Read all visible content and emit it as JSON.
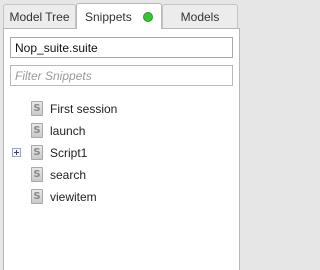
{
  "tabs": [
    {
      "label": "Model Tree",
      "active": false
    },
    {
      "label": "Snippets",
      "active": true,
      "status_color": "#37c437"
    },
    {
      "label": "Models",
      "active": false
    }
  ],
  "suite_input": {
    "value": "Nop_suite.suite"
  },
  "filter_input": {
    "placeholder": "Filter Snippets"
  },
  "snippet_icon_glyph": "S",
  "snippets": [
    {
      "label": "First session",
      "expandable": false
    },
    {
      "label": "launch",
      "expandable": false
    },
    {
      "label": "Script1",
      "expandable": true
    },
    {
      "label": "search",
      "expandable": false
    },
    {
      "label": "viewitem",
      "expandable": false
    }
  ]
}
